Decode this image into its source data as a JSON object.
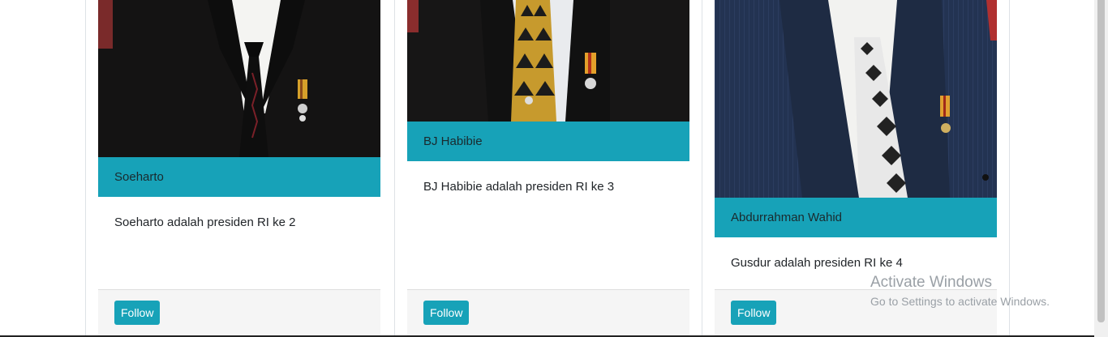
{
  "cards": [
    {
      "name": "Soeharto",
      "description": "Soeharto adalah presiden RI ke 2",
      "button_label": "Follow"
    },
    {
      "name": "BJ Habibie",
      "description": "BJ Habibie adalah presiden RI ke 3",
      "button_label": "Follow"
    },
    {
      "name": "Abdurrahman Wahid",
      "description": "Gusdur adalah presiden RI ke 4",
      "button_label": "Follow"
    }
  ],
  "watermark": {
    "title": "Activate Windows",
    "subtitle": "Go to Settings to activate Windows."
  },
  "colors": {
    "accent": "#17a2b8",
    "footer_bg": "#f5f5f5"
  }
}
